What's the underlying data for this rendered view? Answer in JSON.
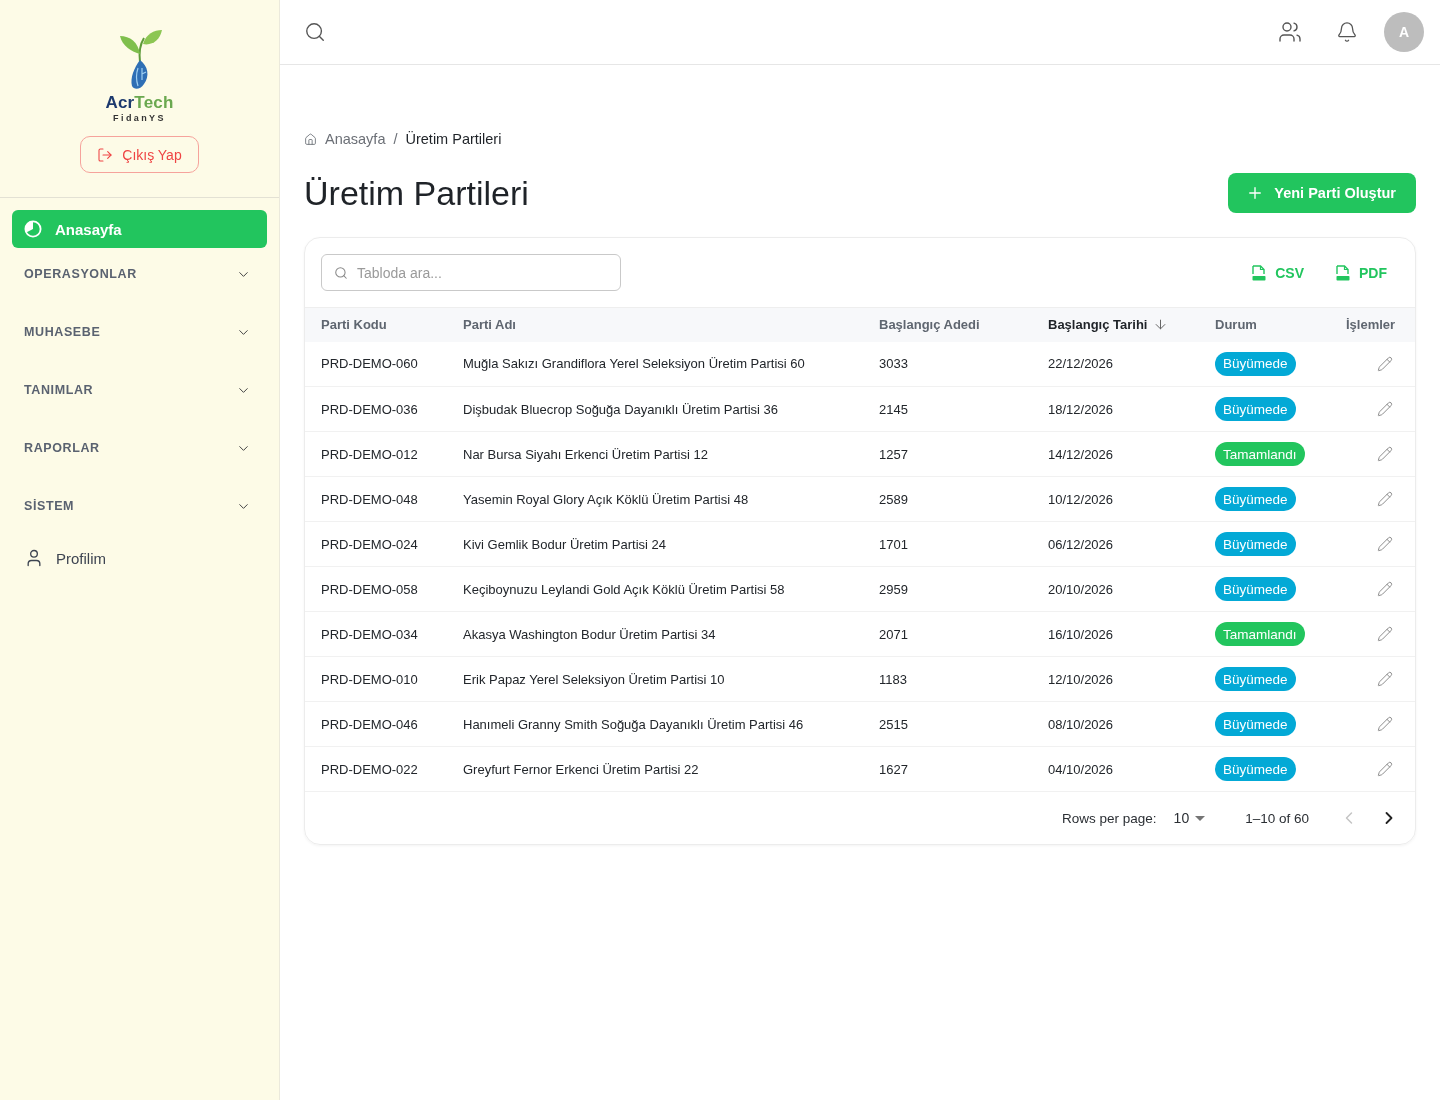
{
  "sidebar": {
    "logo": {
      "name_first": "Acr",
      "name_second": "Tech",
      "subtitle": "FidanYS"
    },
    "logout_button": "Çıkış Yap",
    "items": [
      {
        "kind": "link",
        "label": "Anasayfa",
        "selected": true
      },
      {
        "kind": "group",
        "label": "OPERASYONLAR",
        "expanded": false
      },
      {
        "kind": "group",
        "label": "MUHASEBE",
        "expanded": false
      },
      {
        "kind": "group",
        "label": "TANIMLAR",
        "expanded": false
      },
      {
        "kind": "group",
        "label": "RAPORLAR",
        "expanded": false
      },
      {
        "kind": "group",
        "label": "SİSTEM",
        "expanded": false
      },
      {
        "kind": "link",
        "label": "Profilim",
        "selected": false
      }
    ]
  },
  "topbar": {
    "avatar": "A"
  },
  "breadcrumb": {
    "separator": "/",
    "items": [
      {
        "label": "Anasayfa",
        "current": false
      },
      {
        "label": "Üretim Partileri",
        "current": true
      }
    ]
  },
  "page_title": "Üretim Partileri",
  "create_button": "Yeni Parti Oluştur",
  "table": {
    "search": {
      "placeholder": "Tabloda ara..."
    },
    "exports": [
      "CSV",
      "PDF"
    ],
    "columns": [
      {
        "label": "Parti Kodu",
        "sorted": false
      },
      {
        "label": "Parti Adı",
        "sorted": false
      },
      {
        "label": "Başlangıç Adedi",
        "sorted": false
      },
      {
        "label": "Başlangıç Tarihi",
        "sorted": true
      },
      {
        "label": "Durum",
        "sorted": false
      },
      {
        "label": "İşlemler",
        "sorted": false
      }
    ],
    "rows": [
      {
        "code": "PRD-DEMO-060",
        "name": "Muğla Sakızı Grandiflora Yerel Seleksiyon Üretim Partisi 60",
        "count": "3033",
        "date": "22/12/2026",
        "status": {
          "label": "Büyümede",
          "color": "#03a9d6"
        }
      },
      {
        "code": "PRD-DEMO-036",
        "name": "Dişbudak Bluecrop Soğuğa Dayanıklı Üretim Partisi 36",
        "count": "2145",
        "date": "18/12/2026",
        "status": {
          "label": "Büyümede",
          "color": "#03a9d6"
        }
      },
      {
        "code": "PRD-DEMO-012",
        "name": "Nar Bursa Siyahı Erkenci Üretim Partisi 12",
        "count": "1257",
        "date": "14/12/2026",
        "status": {
          "label": "Tamamlandı",
          "color": "#22c55e"
        }
      },
      {
        "code": "PRD-DEMO-048",
        "name": "Yasemin Royal Glory Açık Köklü Üretim Partisi 48",
        "count": "2589",
        "date": "10/12/2026",
        "status": {
          "label": "Büyümede",
          "color": "#03a9d6"
        }
      },
      {
        "code": "PRD-DEMO-024",
        "name": "Kivi Gemlik Bodur Üretim Partisi 24",
        "count": "1701",
        "date": "06/12/2026",
        "status": {
          "label": "Büyümede",
          "color": "#03a9d6"
        }
      },
      {
        "code": "PRD-DEMO-058",
        "name": "Keçiboynuzu Leylandi Gold Açık Köklü Üretim Partisi 58",
        "count": "2959",
        "date": "20/10/2026",
        "status": {
          "label": "Büyümede",
          "color": "#03a9d6"
        }
      },
      {
        "code": "PRD-DEMO-034",
        "name": "Akasya Washington Bodur Üretim Partisi 34",
        "count": "2071",
        "date": "16/10/2026",
        "status": {
          "label": "Tamamlandı",
          "color": "#22c55e"
        }
      },
      {
        "code": "PRD-DEMO-010",
        "name": "Erik Papaz Yerel Seleksiyon Üretim Partisi 10",
        "count": "1183",
        "date": "12/10/2026",
        "status": {
          "label": "Büyümede",
          "color": "#03a9d6"
        }
      },
      {
        "code": "PRD-DEMO-046",
        "name": "Hanımeli Granny Smith Soğuğa Dayanıklı Üretim Partisi 46",
        "count": "2515",
        "date": "08/10/2026",
        "status": {
          "label": "Büyümede",
          "color": "#03a9d6"
        }
      },
      {
        "code": "PRD-DEMO-022",
        "name": "Greyfurt Fernor Erkenci Üretim Partisi 22",
        "count": "1627",
        "date": "04/10/2026",
        "status": {
          "label": "Büyümede",
          "color": "#03a9d6"
        }
      }
    ],
    "pagination": {
      "rows_label": "Rows per page:",
      "rows_value": "10",
      "range": "1–10 of 60",
      "prev_disabled": true,
      "next_disabled": false
    }
  }
}
